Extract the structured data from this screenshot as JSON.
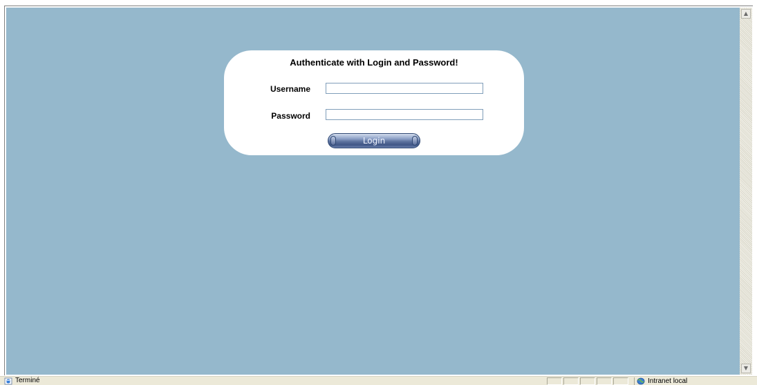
{
  "login": {
    "title": "Authenticate with Login and Password!",
    "username_label": "Username",
    "username_value": "",
    "password_label": "Password",
    "password_value": "",
    "submit_label": "Login"
  },
  "statusbar": {
    "status_text": "Terminé",
    "zone_text": "Intranet local"
  },
  "colors": {
    "page_background": "#95b8cc",
    "panel_background": "#ffffff",
    "button_accent": "#3f5686"
  },
  "icons": {
    "status": "ie-page-icon",
    "zone": "globe-icon",
    "scroll_up": "scroll-up-arrow-icon",
    "scroll_down": "scroll-down-arrow-icon"
  }
}
